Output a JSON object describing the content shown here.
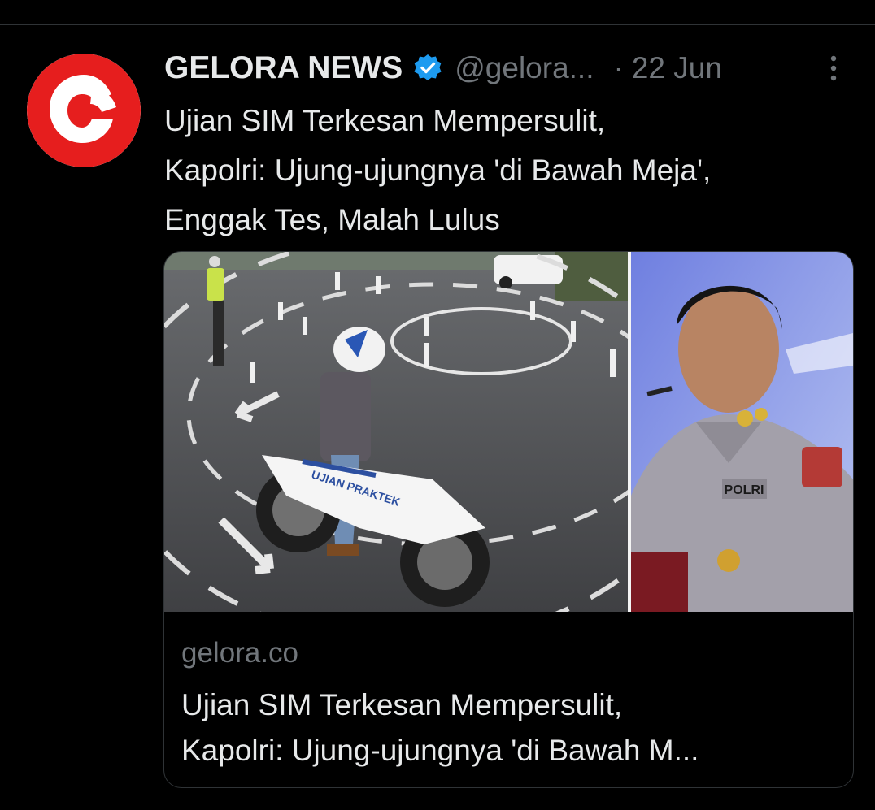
{
  "tweet": {
    "display_name": "GELORA NEWS",
    "handle": "@gelora...",
    "separator": "·",
    "date": "22 Jun",
    "text": "Ujian SIM Terkesan Mempersulit,\nKapolri: Ujung-ujungnya 'di Bawah Meja',\nEnggak Tes, Malah Lulus"
  },
  "card": {
    "domain": "gelora.co",
    "title": "Ujian SIM Terkesan Mempersulit,\nKapolri: Ujung-ujungnya 'di Bawah M...",
    "image_left_text": "UJIAN PRAKTEK",
    "image_right_text": "POLRI"
  },
  "icons": {
    "avatar": "gelora-logo-icon",
    "verified": "verified-badge-icon",
    "more": "more-options-icon"
  },
  "colors": {
    "background": "#000000",
    "primary_text": "#e7e9ea",
    "secondary_text": "#71767b",
    "verified_blue": "#1d9bf0",
    "brand_red": "#e61e1e",
    "border": "#2f3336"
  }
}
